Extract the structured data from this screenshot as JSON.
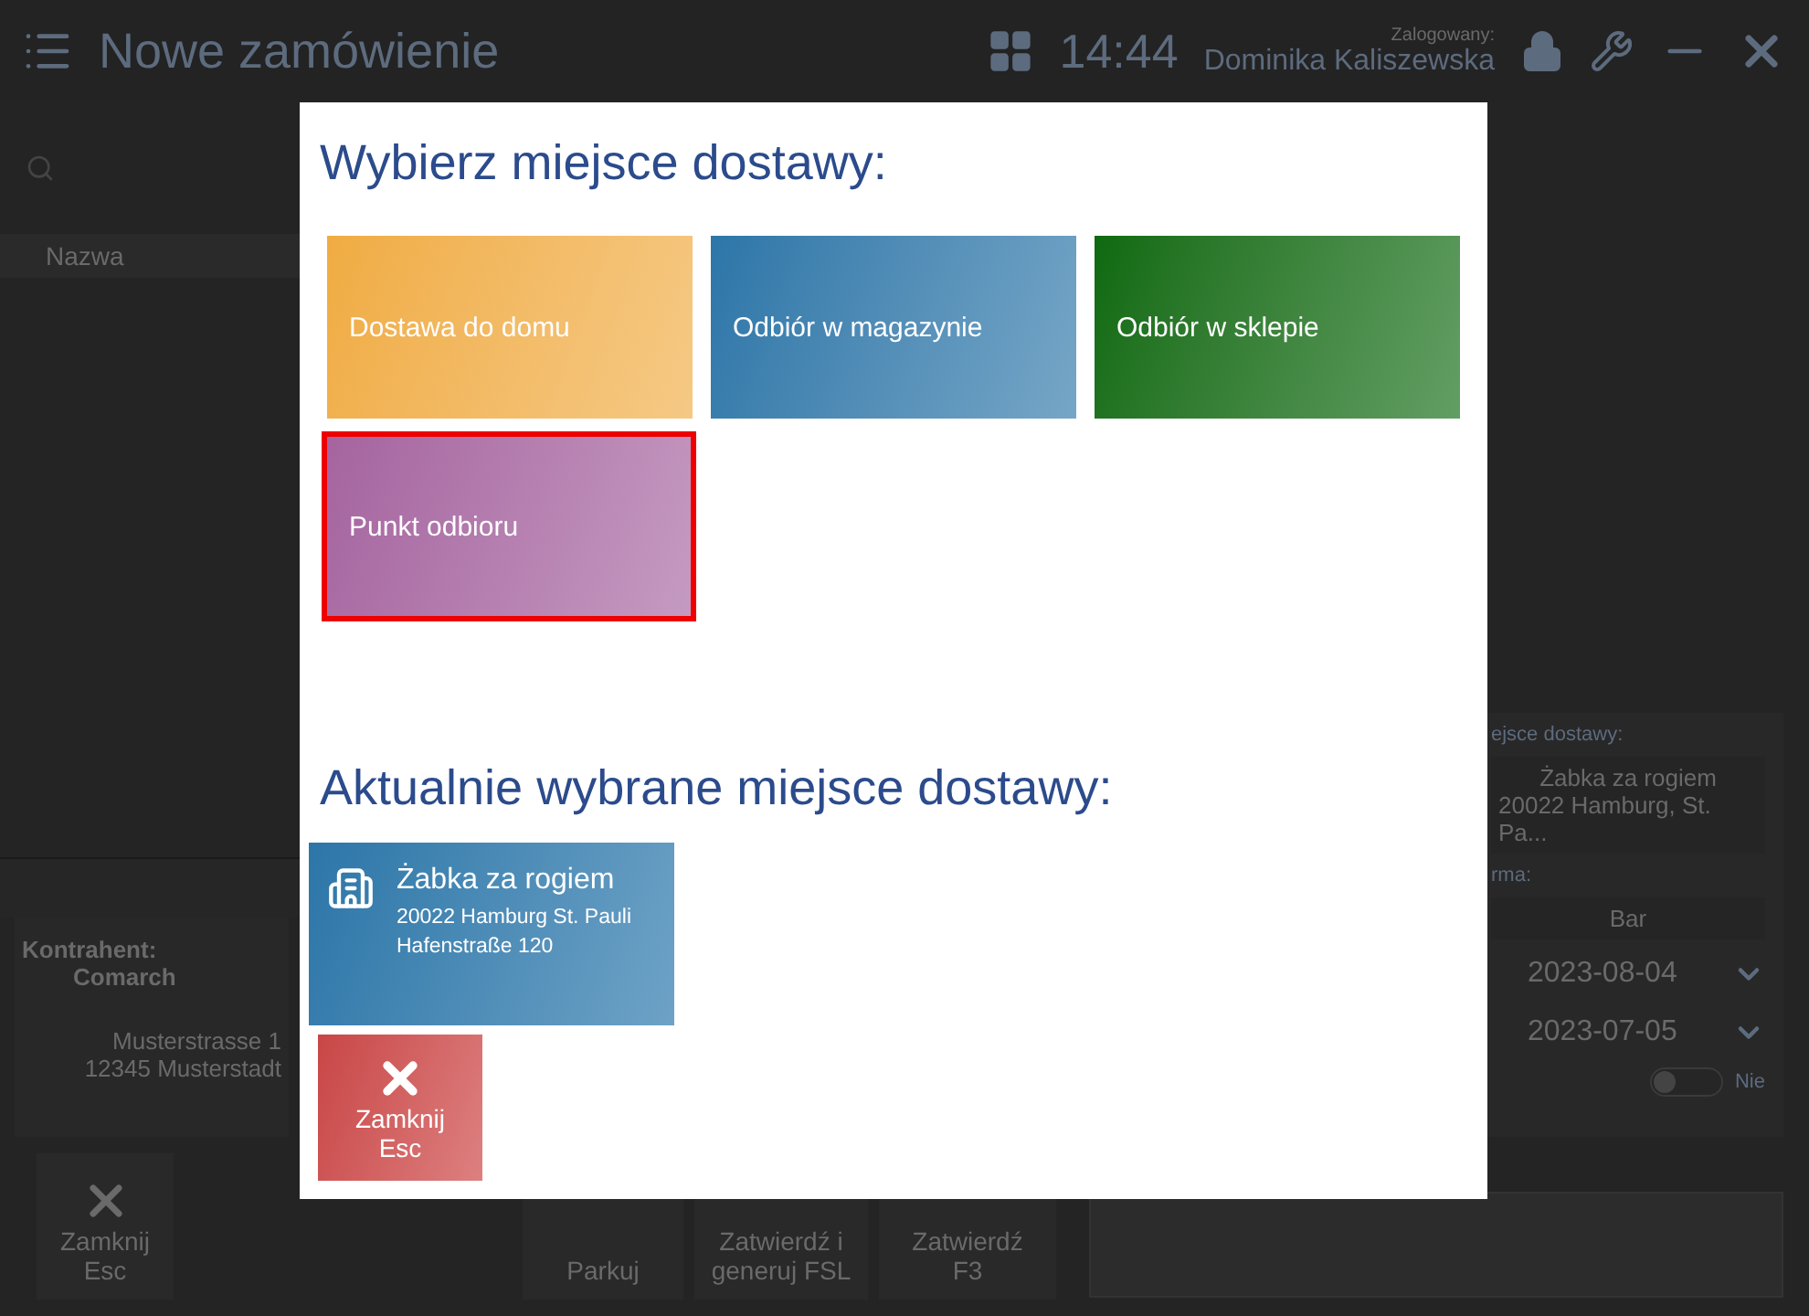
{
  "header": {
    "title": "Nowe zamówienie",
    "time": "14:44",
    "user_label": "Zalogowany:",
    "user_name": "Dominika Kaliszewska"
  },
  "list": {
    "column": "Nazwa"
  },
  "customer": {
    "label": "Kontrahent:",
    "name": "Comarch",
    "address_lines": [
      "Musterstrasse 1",
      "12345 Musterstadt"
    ]
  },
  "bottom_buttons": [
    {
      "kind": "close",
      "label": "Zamknij",
      "key": "Esc"
    },
    {
      "kind": "action",
      "label": "Parkuj"
    },
    {
      "kind": "action",
      "label": "Zatwierdź i",
      "key": "generuj FSL"
    },
    {
      "kind": "action",
      "label": "Zatwierdź",
      "key": "F3"
    }
  ],
  "side_panel": {
    "delivery_label": "ejsce dostawy:",
    "delivery_lines": [
      "Żabka za rogiem",
      "20022 Hamburg, St. Pa..."
    ],
    "payment_label": "rma:",
    "payment_value": "Bar",
    "dates": [
      "2023-08-04",
      "2023-07-05"
    ],
    "toggle": {
      "on": false,
      "label": "Nie"
    }
  },
  "dialog": {
    "title": "Wybierz miejsce dostawy:",
    "options": [
      {
        "label": "Dostawa do domu",
        "color": "#f0ac42",
        "selected": false
      },
      {
        "label": "Odbiór w magazynie",
        "color": "#2c76a8",
        "selected": false
      },
      {
        "label": "Odbiór w sklepie",
        "color": "#0d6a0f",
        "selected": false
      },
      {
        "label": "Punkt odbioru",
        "color": "#a5649f",
        "selected": true
      }
    ],
    "current_title": "Aktualnie wybrane miejsce dostawy:",
    "current": {
      "name": "Żabka za rogiem",
      "lines": [
        "20022 Hamburg St. Pauli",
        "Hafenstraße 120"
      ]
    },
    "close_button": {
      "label": "Zamknij",
      "key": "Esc"
    }
  }
}
